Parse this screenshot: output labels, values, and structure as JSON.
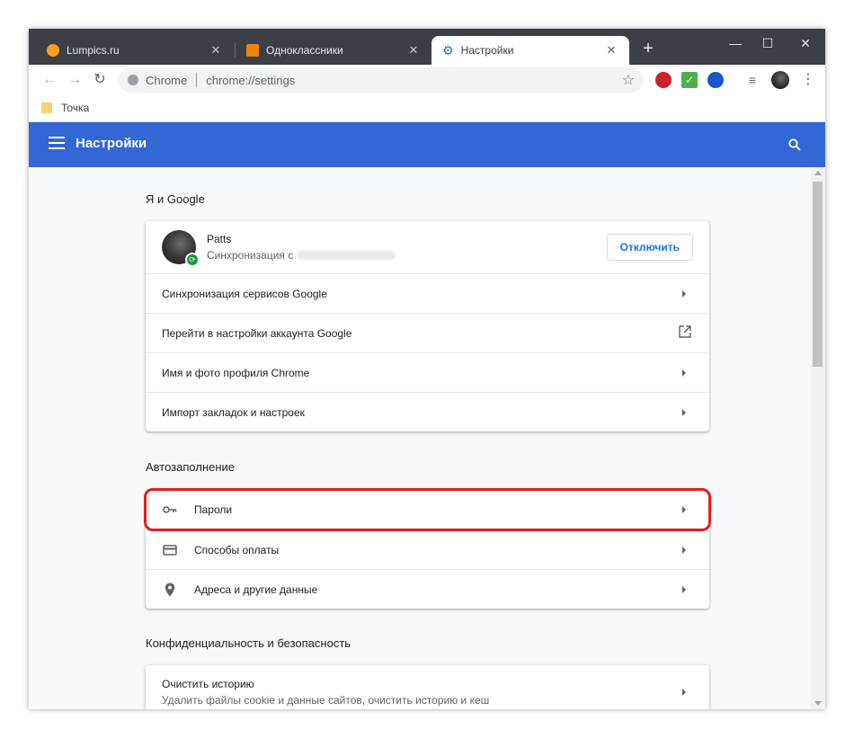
{
  "tabs": [
    {
      "title": "Lumpics.ru",
      "favicon_color": "#f7a11c"
    },
    {
      "title": "Одноклассники",
      "favicon_color": "#ee8208"
    },
    {
      "title": "Настройки",
      "favicon_color": "#1a73e8"
    }
  ],
  "omnibox": {
    "site": "Chrome",
    "url": "chrome://settings"
  },
  "bookmarks": [
    {
      "label": "Точка"
    }
  ],
  "header": {
    "title": "Настройки"
  },
  "sections": {
    "you_google": {
      "title": "Я и Google",
      "profile": {
        "name": "Patts",
        "sync_text": "Синхронизация с",
        "button": "Отключить"
      },
      "rows": [
        "Синхронизация сервисов Google",
        "Перейти в настройки аккаунта Google",
        "Имя и фото профиля Chrome",
        "Импорт закладок и настроек"
      ]
    },
    "autofill": {
      "title": "Автозаполнение",
      "rows": [
        "Пароли",
        "Способы оплаты",
        "Адреса и другие данные"
      ]
    },
    "privacy": {
      "title": "Конфиденциальность и безопасность",
      "rows": [
        {
          "label": "Очистить историю",
          "sub": "Удалить файлы cookie и данные сайтов, очистить историю и кеш"
        }
      ]
    }
  },
  "colors": {
    "header": "#3367d6",
    "highlight": "#e01d1d",
    "tabstrip": "#3c3f45"
  }
}
